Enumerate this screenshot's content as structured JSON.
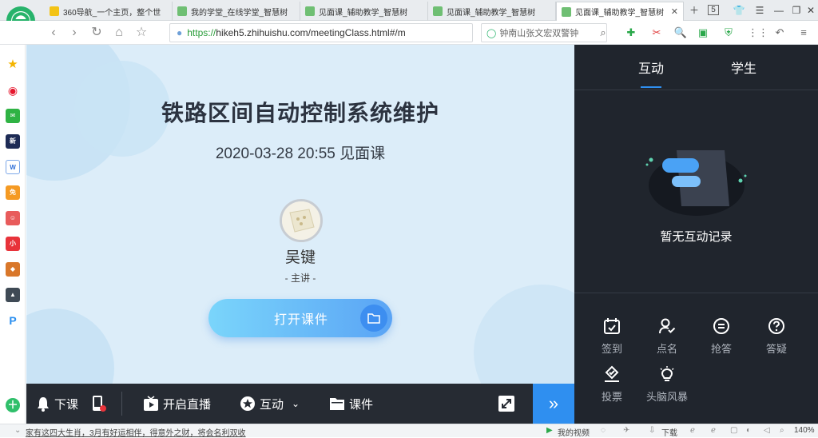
{
  "browser": {
    "tabs": [
      {
        "title": "360导航_一个主页，整个世"
      },
      {
        "title": "我的学堂_在线学堂_智慧树"
      },
      {
        "title": "见面课_辅助教学_智慧树"
      },
      {
        "title": "见面课_辅助教学_智慧树"
      },
      {
        "title": "见面课_辅助教学_智慧树"
      }
    ],
    "tab_count_badge": "5",
    "url_scheme": "https://",
    "url_rest": "hikeh5.zhihuishu.com/meetingClass.html#/m",
    "search_text": "钟南山张文宏双警钟"
  },
  "stage": {
    "course_title": "铁路区间自动控制系统维护",
    "datetime": "2020-03-28 20:55 见面课",
    "teacher_name": "吴键",
    "teacher_role": "- 主讲 -",
    "open_button": "打开课件"
  },
  "toolbar": {
    "end_class": "下课",
    "start_live": "开启直播",
    "interact": "互动",
    "courseware": "课件"
  },
  "panel": {
    "tab_interact": "互动",
    "tab_students": "学生",
    "empty_text": "暂无互动记录",
    "tools": [
      {
        "label": "签到",
        "icon": "calendar-check-icon"
      },
      {
        "label": "点名",
        "icon": "person-check-icon"
      },
      {
        "label": "抢答",
        "icon": "chat-bubble-icon"
      },
      {
        "label": "答疑",
        "icon": "question-icon"
      },
      {
        "label": "投票",
        "icon": "vote-icon"
      },
      {
        "label": "头脑风暴",
        "icon": "lightbulb-icon"
      }
    ]
  },
  "statusbar": {
    "news": "家有这四大生肖，3月有好运相伴，得意外之财，将会名利双收",
    "my_video": "我的视频",
    "download": "下载",
    "zoom": "140%"
  },
  "colors": {
    "accent_blue": "#2f8ff0",
    "dark_panel": "#20252d",
    "toolbar_dark": "#262b33",
    "stage_bg": "#dcedf9"
  }
}
